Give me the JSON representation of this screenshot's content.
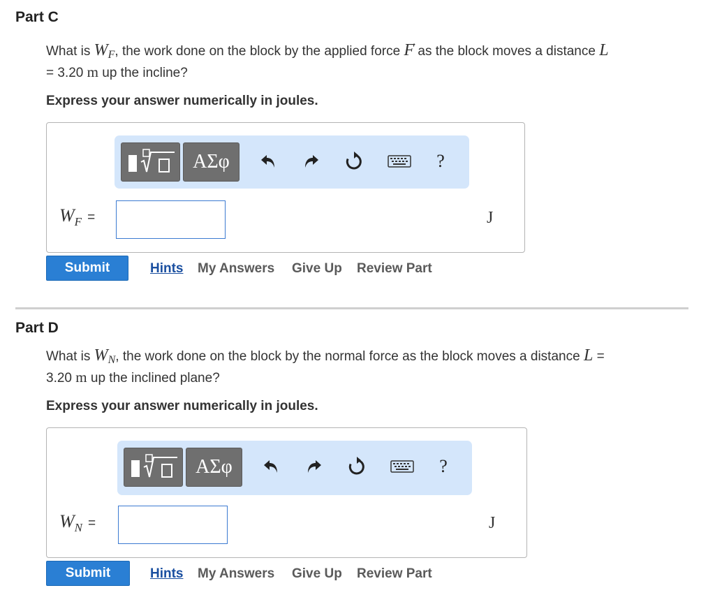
{
  "part_c": {
    "title": "Part C",
    "q_pre": "What is ",
    "q_var": "W",
    "q_var_sub": "F",
    "q_mid1": ", the work done on the block by the applied force ",
    "q_force": "F",
    "q_mid2": " as the block moves a distance ",
    "q_L": "L",
    "q_eq": "= 3.20 ",
    "q_unit": "m",
    "q_post": " up the incline?",
    "instruction": "Express your answer numerically in joules.",
    "label_var": "W",
    "label_sub": "F",
    "label_eq": "=",
    "answer_value": "",
    "unit": "J"
  },
  "part_d": {
    "title": "Part D",
    "q_pre": "What is ",
    "q_var": "W",
    "q_var_sub": "N",
    "q_mid": ", the work done on the block by the normal force as the block moves a distance ",
    "q_L": "L",
    "q_eq": " =",
    "q_line2_num": "3.20 ",
    "q_unit": "m",
    "q_post": " up the inclined plane?",
    "instruction": "Express your answer numerically in joules.",
    "label_var": "W",
    "label_sub": "N",
    "label_eq": "=",
    "answer_value": "",
    "unit": "J"
  },
  "toolbar": {
    "greek_label": "ΑΣφ",
    "help_label": "?",
    "icons": [
      "templates-icon",
      "greek-symbols-icon",
      "undo-icon",
      "redo-icon",
      "reset-icon",
      "keyboard-icon",
      "help-icon"
    ]
  },
  "actions": {
    "submit": "Submit",
    "hints": "Hints",
    "my_answers": "My Answers",
    "give_up": "Give Up",
    "review_part": "Review Part"
  },
  "colors": {
    "toolbar_bg": "#d4e6fb",
    "submit_bg": "#2a7fd4",
    "hints_link": "#1a4fa0",
    "input_border": "#3b7ad1"
  }
}
